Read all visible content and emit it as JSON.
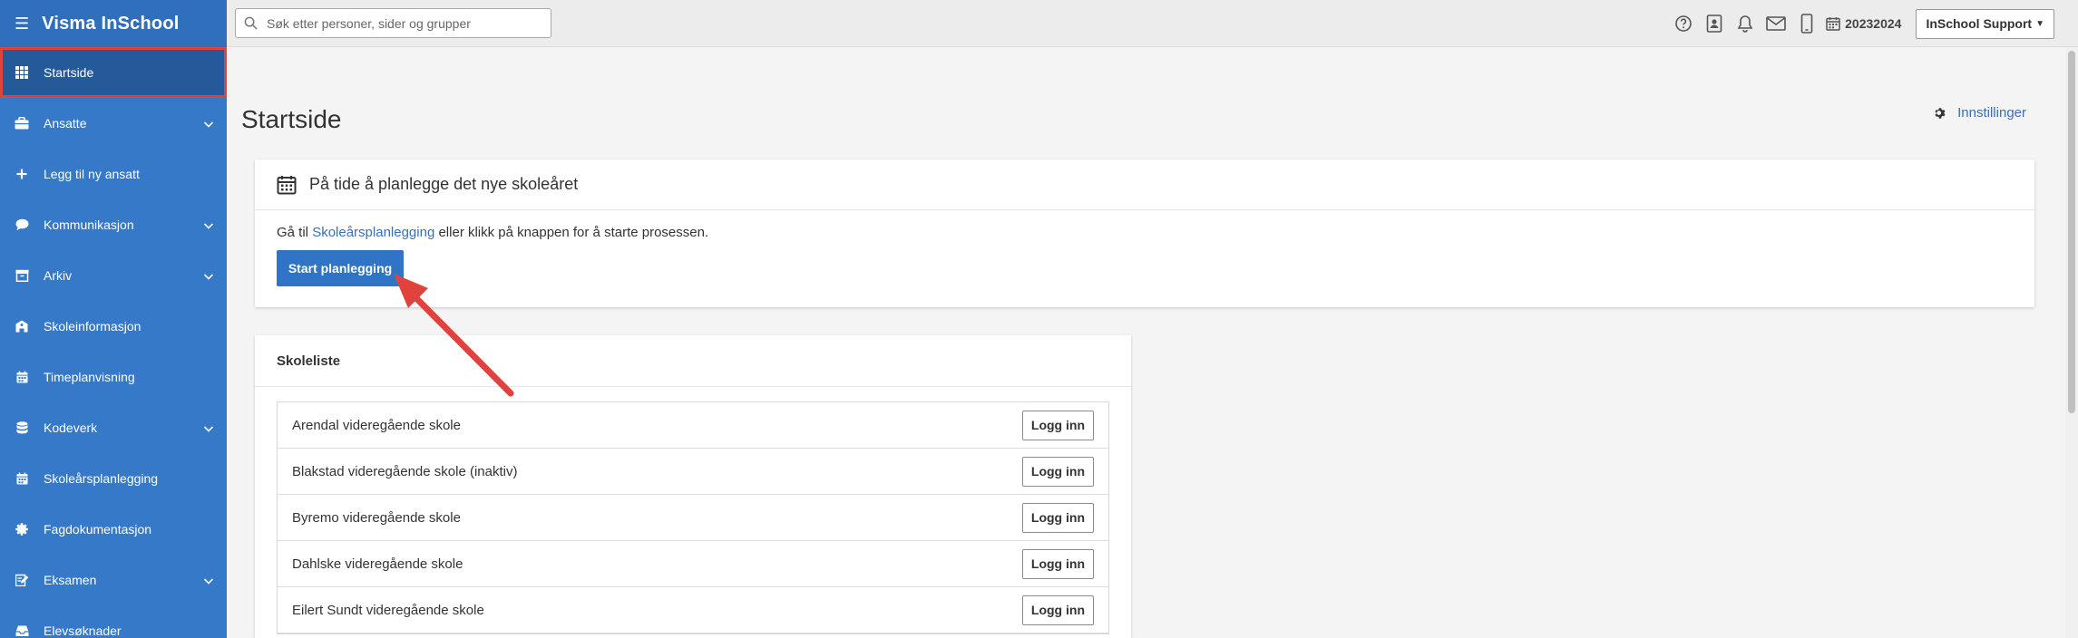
{
  "app": {
    "title": "Visma InSchool"
  },
  "sidebar": {
    "items": [
      {
        "label": "Startside",
        "icon": "grid-icon",
        "expandable": false,
        "active": true
      },
      {
        "label": "Ansatte",
        "icon": "briefcase-icon",
        "expandable": true
      },
      {
        "label": "Legg til ny ansatt",
        "icon": "plus-icon",
        "expandable": false
      },
      {
        "label": "Kommunikasjon",
        "icon": "chat-icon",
        "expandable": true
      },
      {
        "label": "Arkiv",
        "icon": "archive-icon",
        "expandable": true
      },
      {
        "label": "Skoleinformasjon",
        "icon": "school-icon",
        "expandable": false
      },
      {
        "label": "Timeplanvisning",
        "icon": "calendar-icon",
        "expandable": false
      },
      {
        "label": "Kodeverk",
        "icon": "database-icon",
        "expandable": true
      },
      {
        "label": "Skoleårsplanlegging",
        "icon": "calendar-icon",
        "expandable": false
      },
      {
        "label": "Fagdokumentasjon",
        "icon": "badge-icon",
        "expandable": false
      },
      {
        "label": "Eksamen",
        "icon": "edit-icon",
        "expandable": true
      },
      {
        "label": "Elevsøknader",
        "icon": "inbox-icon",
        "expandable": false
      }
    ]
  },
  "topbar": {
    "search_placeholder": "Søk etter personer, sider og grupper",
    "icons": [
      "help-icon",
      "contact-card-icon",
      "bell-icon",
      "mail-icon",
      "mobile-icon"
    ],
    "school_year": "20232024",
    "user_label": "InSchool Support"
  },
  "main": {
    "page_title": "Startside",
    "settings_label": "Innstillinger",
    "planning_card": {
      "title": "På tide å planlegge det nye skoleåret",
      "text_prefix": "Gå til ",
      "link_text": "Skoleårsplanlegging",
      "text_suffix": " eller klikk på knappen for å starte prosessen.",
      "button_label": "Start planlegging"
    },
    "school_list": {
      "title": "Skoleliste",
      "login_label": "Logg inn",
      "schools": [
        "Arendal videregående skole",
        "Blakstad videregående skole (inaktiv)",
        "Byremo videregående skole",
        "Dahlske videregående skole",
        "Eilert Sundt videregående skole"
      ]
    }
  },
  "colors": {
    "sidebar": "#3579c8",
    "sidebar_active": "#245a9a",
    "highlight": "#e0433d",
    "accent": "#2f74c5",
    "link": "#3a6fb8"
  }
}
